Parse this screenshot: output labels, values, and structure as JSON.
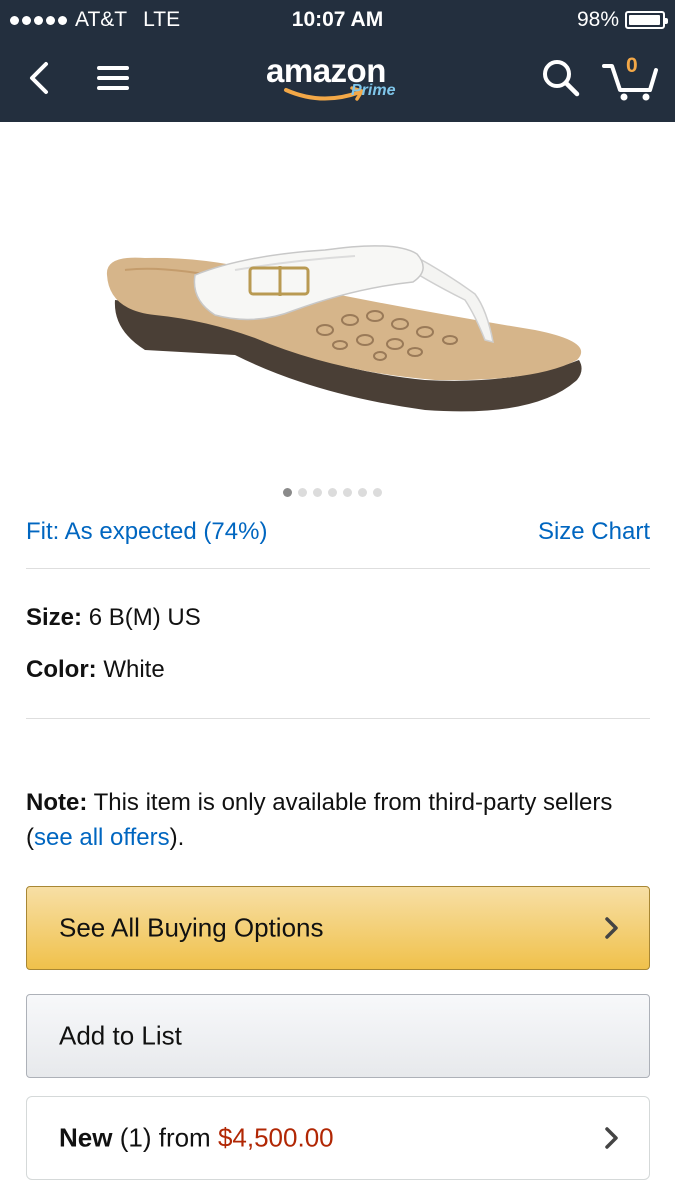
{
  "status_bar": {
    "carrier": "AT&T",
    "network": "LTE",
    "time": "10:07 AM",
    "battery": "98%",
    "battery_level": 0.98
  },
  "nav": {
    "logo_word": "amazon",
    "logo_sub": "Prime",
    "cart_count": "0",
    "icons": [
      "back-arrow-icon",
      "hamburger-menu-icon",
      "search-icon",
      "cart-icon"
    ],
    "colors": {
      "bar": "#232f3e",
      "accent": "#f3a847",
      "prime": "#7fc6ea"
    }
  },
  "product": {
    "image_description_icon": "sandal-image",
    "carousel": {
      "count": 7,
      "active_index": 0
    }
  },
  "fit": {
    "text": "Fit: As expected (74%)",
    "size_chart": "Size Chart"
  },
  "attributes": {
    "size_label": "Size:",
    "size_value": "6 B(M) US",
    "color_label": "Color:",
    "color_value": "White"
  },
  "note": {
    "label": "Note:",
    "text_before": "This item is only available from third-party sellers (",
    "link": "see all offers",
    "text_after": ")."
  },
  "buttons": {
    "buying_options": "See All Buying Options",
    "add_to_list": "Add to List"
  },
  "offer": {
    "condition": "New",
    "count": "(1)",
    "from": "from",
    "price": "$4,500.00"
  },
  "colors": {
    "link": "#0066c0",
    "price": "#b12704",
    "button_primary": "#f0c14b"
  }
}
